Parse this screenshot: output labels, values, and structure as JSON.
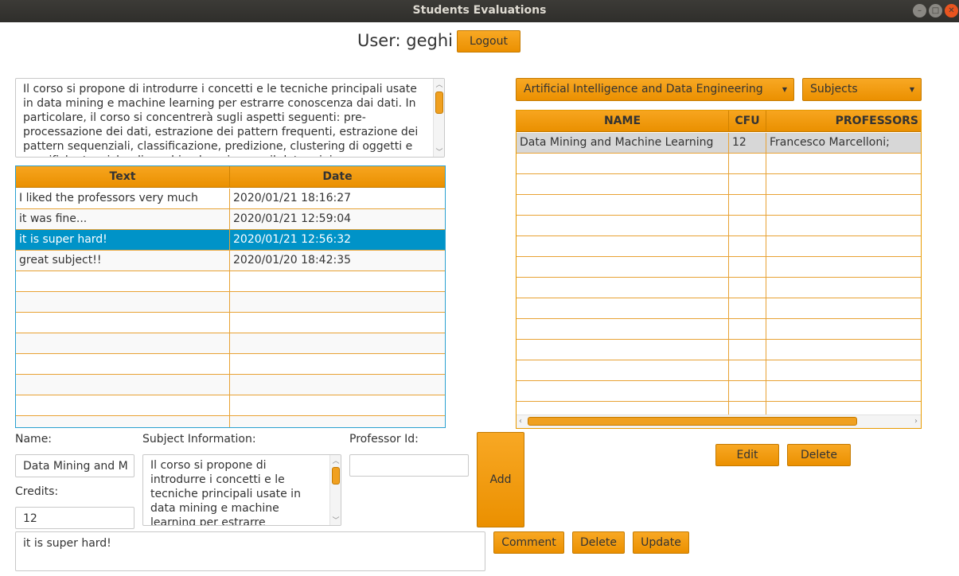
{
  "window": {
    "title": "Students Evaluations"
  },
  "header": {
    "user_label": "User: geghi",
    "logout_label": "Logout"
  },
  "description": {
    "text": "Il corso si propone di introdurre i concetti e le tecniche principali usate in data mining e machine learning per estrarre conoscenza dai dati. In particolare, il corso si concentrerà sugli aspetti seguenti: pre-processazione dei dati, estrazione dei pattern frequenti, estrazione dei pattern sequenziali, classificazione, predizione, clustering di oggetti e specifiche tecniche di machine learning per il data mining."
  },
  "comments_table": {
    "columns": [
      "Text",
      "Date"
    ],
    "rows": [
      {
        "text": "I liked the professors very much",
        "date": "2020/01/21 18:16:27"
      },
      {
        "text": "it was fine...",
        "date": "2020/01/21 12:59:04"
      },
      {
        "text": "it is super hard!",
        "date": "2020/01/21 12:56:32"
      },
      {
        "text": "great subject!!",
        "date": "2020/01/20 18:42:35"
      }
    ],
    "selected_index": 2
  },
  "form": {
    "name_label": "Name:",
    "name_value": "Data Mining and M",
    "credits_label": "Credits:",
    "credits_value": "12",
    "subject_info_label": "Subject Information:",
    "subject_info_value": "Il corso si propone di introdurre i concetti e le tecniche principali usate in data mining e machine learning per estrarre conoscenza dai dati.",
    "professor_id_label": "Professor Id:",
    "professor_id_value": "",
    "add_label": "Add",
    "comment_value": "it is super hard!",
    "comment_button": "Comment",
    "delete_button": "Delete",
    "update_button": "Update"
  },
  "filters": {
    "degree_selected": "Artificial Intelligence and Data Engineering",
    "view_selected": "Subjects"
  },
  "subjects_table": {
    "columns": [
      "NAME",
      "CFU",
      "PROFESSORS"
    ],
    "rows": [
      {
        "name": "Data Mining and Machine Learning",
        "cfu": "12",
        "professors": "Francesco Marcelloni;"
      }
    ],
    "selected_index": 0
  },
  "subjects_actions": {
    "edit_label": "Edit",
    "delete_label": "Delete"
  },
  "colors": {
    "accent": "#f0a020",
    "selection": "#0093c8",
    "titlebar": "#3c3b37"
  }
}
